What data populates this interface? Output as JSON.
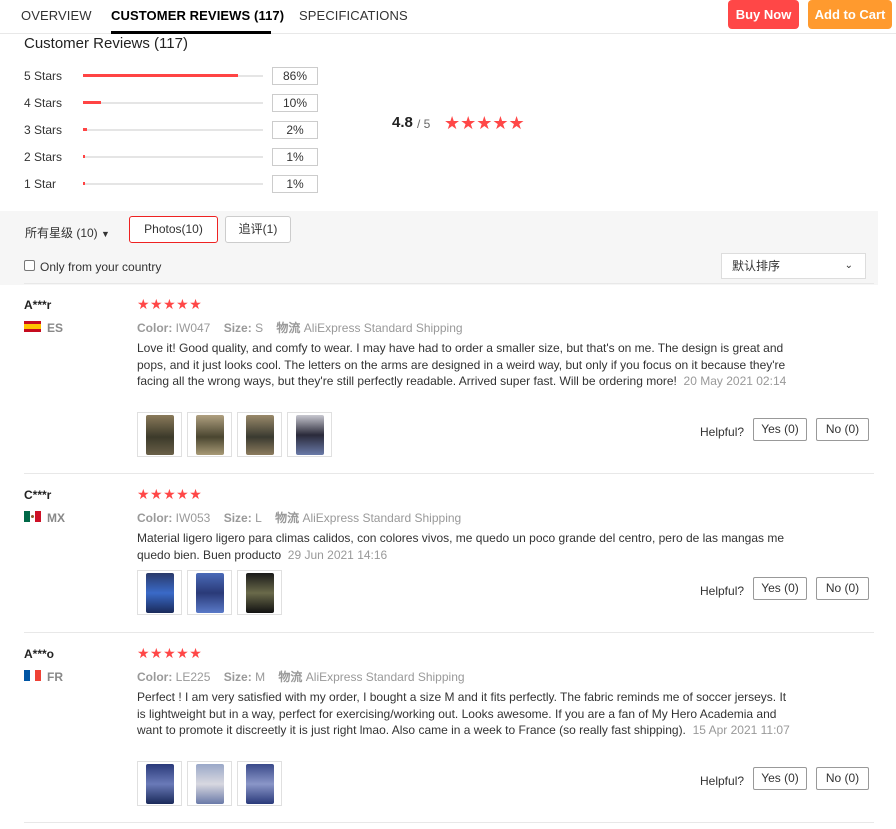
{
  "nav": {
    "tabs": [
      "OVERVIEW",
      "CUSTOMER REVIEWS (117)",
      "SPECIFICATIONS"
    ],
    "buy_now": "Buy Now",
    "add_to_cart": "Add to Cart"
  },
  "summary": {
    "title": "Customer Reviews (117)",
    "rows": [
      {
        "label": "5 Stars",
        "pct": "86%",
        "fraction": 0.86
      },
      {
        "label": "4 Stars",
        "pct": "10%",
        "fraction": 0.1
      },
      {
        "label": "3 Stars",
        "pct": "2%",
        "fraction": 0.02
      },
      {
        "label": "2 Stars",
        "pct": "1%",
        "fraction": 0.01
      },
      {
        "label": "1 Star",
        "pct": "1%",
        "fraction": 0.01
      }
    ],
    "average": "4.8",
    "out_of": "/ 5",
    "stars": "★★★★★"
  },
  "filters": {
    "all_stars": "所有星级 (10)",
    "photos": "Photos(10)",
    "followup": "追评(1)",
    "country_only": "Only from your country",
    "sort": "默认排序",
    "sort_chevron": "⌄"
  },
  "labels": {
    "color": "Color:",
    "size": "Size:",
    "shipping": "物流",
    "helpful": "Helpful?",
    "yes": "Yes (0)",
    "no": "No (0)"
  },
  "reviews": [
    {
      "name": "A***r",
      "country": "ES",
      "stars": "★★★★★",
      "color": "IW047",
      "size": "S",
      "shipping": "AliExpress Standard Shipping",
      "text": "Love it! Good quality, and comfy to wear. I may have had to order a smaller size, but that's on me. The design is great and pops, and it just looks cool. The letters on the arms are designed in a weird way, but only if you focus on it because they're facing all the wrong ways, but they're still perfectly readable. Arrived super fast. Will be ordering more!",
      "date": "20 May 2021 02:14"
    },
    {
      "name": "C***r",
      "country": "MX",
      "stars": "★★★★★",
      "color": "IW053",
      "size": "L",
      "shipping": "AliExpress Standard Shipping",
      "text": "Material ligero ligero para climas calidos, con colores vivos, me quedo un poco grande del centro, pero de las mangas me quedo bien. Buen producto",
      "date": "29 Jun 2021 14:16"
    },
    {
      "name": "A***o",
      "country": "FR",
      "stars": "★★★★★",
      "color": "LE225",
      "size": "M",
      "shipping": "AliExpress Standard Shipping",
      "text": "Perfect ! I am very satisfied with my order, I bought a size M and it fits perfectly. The fabric reminds me of soccer jerseys. It is lightweight but in a way, perfect for exercising/working out. Looks awesome. If you are a fan of My Hero Academia and want to promote it discreetly it is just right lmao. Also came in a week to France (so really fast shipping).",
      "date": "15 Apr 2021 11:07"
    }
  ],
  "colors": {
    "accent_red": "#ff4747",
    "accent_orange": "#ff9a2e"
  }
}
